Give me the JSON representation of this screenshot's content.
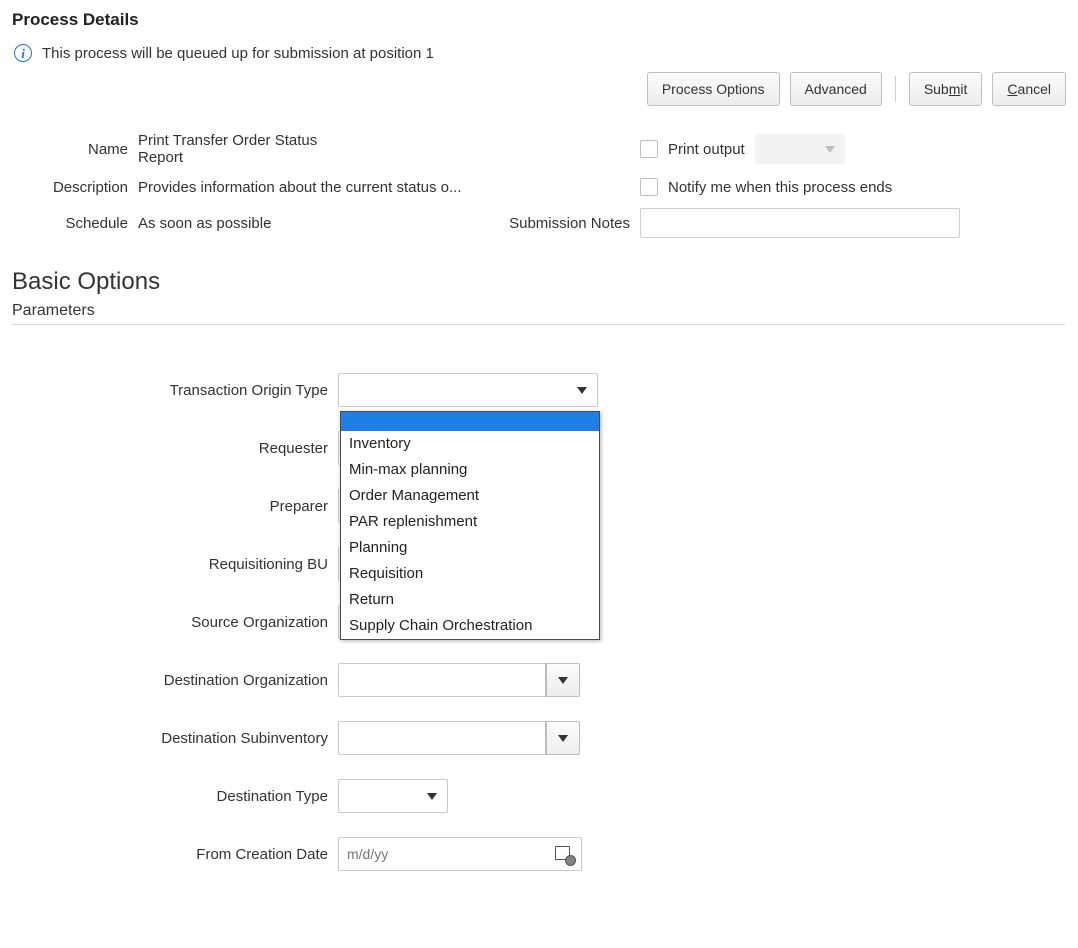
{
  "page_title": "Process Details",
  "info_message": "This process will be queued up for submission at position 1",
  "toolbar": {
    "process_options": "Process Options",
    "advanced": "Advanced",
    "submit_pre": "Sub",
    "submit_ul": "m",
    "submit_post": "it",
    "cancel_ul": "C",
    "cancel_post": "ancel"
  },
  "details": {
    "name_label": "Name",
    "name_value": "Print Transfer Order Status Report",
    "description_label": "Description",
    "description_value": "Provides information about the current status o...",
    "schedule_label": "Schedule",
    "schedule_value": "As soon as possible",
    "submission_notes_label": "Submission Notes",
    "submission_notes_value": "",
    "print_output_label": "Print output",
    "notify_label": "Notify me when this process ends"
  },
  "section_heading": "Basic Options",
  "parameters_heading": "Parameters",
  "params": {
    "transaction_origin_type_label": "Transaction Origin Type",
    "requester_label": "Requester",
    "preparer_label": "Preparer",
    "requisitioning_bu_label": "Requisitioning BU",
    "source_organization_label": "Source Organization",
    "destination_organization_label": "Destination Organization",
    "destination_subinventory_label": "Destination Subinventory",
    "destination_type_label": "Destination Type",
    "from_creation_date_label": "From Creation Date",
    "from_creation_date_placeholder": "m/d/yy"
  },
  "transaction_origin_type_options": [
    "",
    "Inventory",
    "Min-max planning",
    "Order Management",
    "PAR replenishment",
    "Planning",
    "Requisition",
    "Return",
    "Supply Chain Orchestration"
  ]
}
